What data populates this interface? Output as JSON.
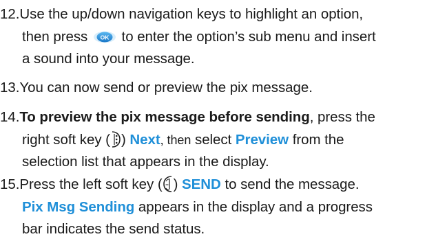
{
  "steps": [
    {
      "number": "12.",
      "line1": "Use the up/down navigation keys to highlight an option,",
      "line2a": "then press",
      "ok_icon": "ok-key-icon",
      "ok_text": "OK",
      "line2b": "to enter the option’s sub menu and insert",
      "line3": "a sound into your message."
    },
    {
      "number": "13.",
      "line1": "You can now send or preview the pix message."
    },
    {
      "number": "14.",
      "bold": "To preview the pix message before sending",
      "line1b": ", press the",
      "line2a": "right soft key (",
      "softkey_icon": "right-soft-key-icon",
      "line2b": ") ",
      "next": "Next",
      "then": ", then",
      "select": " select ",
      "preview": "Preview",
      "line2c": " from the",
      "line3": "selection list that appears in the display."
    },
    {
      "number": "15.",
      "line1a": "Press the left soft key (",
      "softkey_icon": "left-soft-key-icon",
      "line1b": ") ",
      "send": "SEND",
      "line1c": " to send the message.",
      "status": "Pix Msg Sending",
      "line2b": " appears in the display and a progress",
      "line3": "bar indicates the send status."
    }
  ],
  "colors": {
    "accent": "#1f8fd8",
    "text": "#1a1a1a"
  }
}
